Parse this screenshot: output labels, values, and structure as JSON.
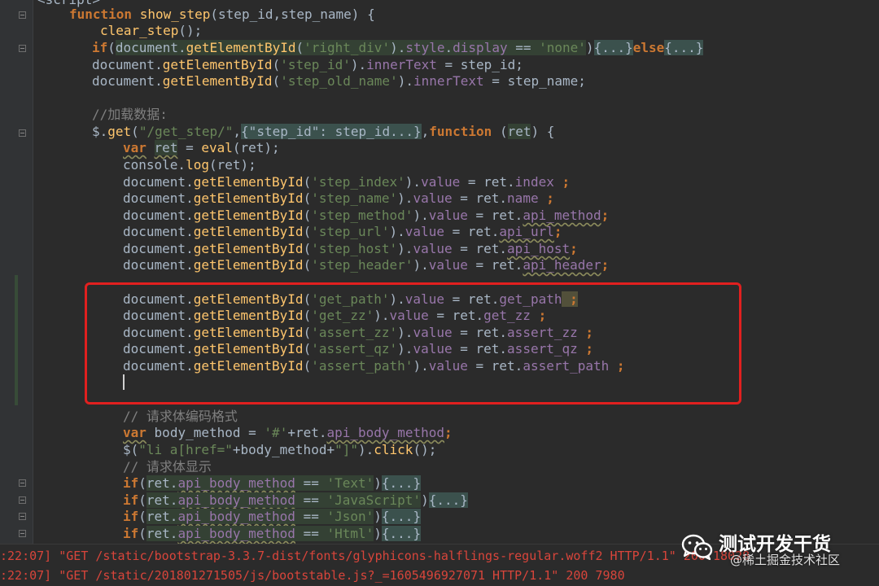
{
  "code_lines": {
    "l0": "<script>",
    "l1_kw": "function",
    "l1_fn": "show_step",
    "l1_rest": "(step_id,step_name) {",
    "l2_fn": "clear_step",
    "l2_rest": "();",
    "l3_kw": "if",
    "l3_a": "document.",
    "l3_fn": "getElementById",
    "l3_str": "'right_div'",
    "l3_b": ").",
    "l3_prop1": "style",
    "l3_dot": ".",
    "l3_prop2": "display",
    "l3_eq": " == ",
    "l3_str2": "'none'",
    "l3_fold1": "{...}",
    "l3_else": "else",
    "l3_fold2": "{...}",
    "l4_a": "document.",
    "l4_fn": "getElementById",
    "l4_str": "'step_id'",
    "l4_b": ").",
    "l4_prop": "innerText",
    "l4_c": " = step_id;",
    "l5_a": "document.",
    "l5_fn": "getElementById",
    "l5_str": "'step_old_name'",
    "l5_b": ").",
    "l5_prop": "innerText",
    "l5_c": " = step_name;",
    "l7_cmt": "//加载数据:",
    "l8_a": "$.",
    "l8_fn": "get",
    "l8_str": "\"/get_step/\"",
    "l8_fold": "{\"step_id\": step_id...}",
    "l8_kw": "function",
    "l8_ret": "ret",
    "l8_c": ") {",
    "l9_kw": "var",
    "l9_var": "ret",
    "l9_b": " = ",
    "l9_fn": "eval",
    "l9_c": "(ret);",
    "l10_a": "console.",
    "l10_fn": "log",
    "l10_c": "(ret);",
    "l11_str": "'step_index'",
    "l11_prop": "index",
    "l12_str": "'step_name'",
    "l12_prop": "name",
    "l13_str": "'step_method'",
    "l13_prop": "api_method",
    "l14_str": "'step_url'",
    "l14_prop": "api_url",
    "l15_str": "'step_host'",
    "l15_prop": "api_host",
    "l16_str": "'step_header'",
    "l16_prop": "api_header",
    "l18_str": "'get_path'",
    "l18_prop": "get_path",
    "l19_str": "'get_zz'",
    "l19_prop": "get_zz",
    "l20_str": "'assert_zz'",
    "l20_prop": "assert_zz",
    "l21_str": "'assert_qz'",
    "l21_prop": "assert_qz",
    "l22_str": "'assert_path'",
    "l22_prop": "assert_path",
    "l24_cmt": "// 请求体编码格式",
    "l25_kw": "var",
    "l25_var": "body_method",
    "l25_b": " = ",
    "l25_str": "'#'",
    "l25_c": "+ret.",
    "l25_prop": "api_body_method",
    "l25_d": ";",
    "l26_a": "$(",
    "l26_str": "\"li a[href=\"",
    "l26_b": "+body_method+",
    "l26_str2": "\"]\"",
    "l26_c": ").",
    "l26_fn": "click",
    "l26_d": "();",
    "l27_cmt": "// 请求体显示",
    "l28_str": "'Text'",
    "l29_str": "'JavaScript'",
    "l30_str": "'Json'",
    "l31_str": "'Html'",
    "common_doc": "document.",
    "common_fn": "getElementById",
    "common_paren": "(",
    "common_value": ").",
    "common_valprop": "value",
    "common_assign": " = ret.",
    "common_semi": ";",
    "common_semi_sp": " ;",
    "common_if": "if",
    "common_ret": "ret.",
    "common_abm": "api_body_method",
    "common_eqeq": " == ",
    "common_fold": "{...}",
    "common_close": ")"
  },
  "terminal": {
    "line1": ":22:07] \"GET /static/bootstrap-3.3.7-dist/fonts/glyphicons-halflings-regular.woff2 HTTP/1.1\" 200 18028",
    "line2": ":22:07] \"GET /static/201801271505/js/bootstable.js?_=1605496927071 HTTP/1.1\" 200 7980"
  },
  "watermark": {
    "title": "测试开发干货",
    "subtitle": "@稀土掘金技术社区"
  },
  "colors": {
    "background": "#2B2B2B",
    "keyword": "#CC7832",
    "function": "#FFC66D",
    "string": "#6A8759",
    "property": "#9876AA",
    "comment": "#808080",
    "highlight_box": "#E1201F"
  }
}
